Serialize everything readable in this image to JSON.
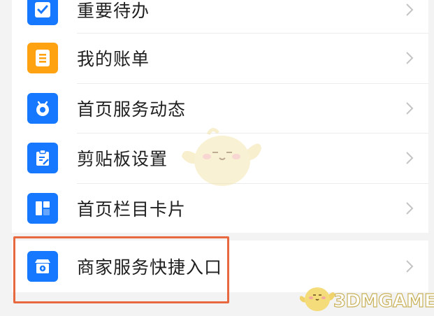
{
  "menu": {
    "items": [
      {
        "label": "重要待办",
        "icon": "todo-check-icon",
        "color": "#1677ff"
      },
      {
        "label": "我的账单",
        "icon": "bill-icon",
        "color": "#ffa211"
      },
      {
        "label": "首页服务动态",
        "icon": "service-feed-icon",
        "color": "#1677ff"
      },
      {
        "label": "剪贴板设置",
        "icon": "clipboard-icon",
        "color": "#1677ff"
      },
      {
        "label": "首页栏目卡片",
        "icon": "column-card-icon",
        "color": "#1677ff"
      }
    ],
    "merchant_item": {
      "label": "商家服务快捷入口",
      "icon": "merchant-store-icon",
      "color": "#1677ff"
    }
  },
  "highlight_color": "#e8683f",
  "watermark": {
    "text": "3DMGAME"
  }
}
